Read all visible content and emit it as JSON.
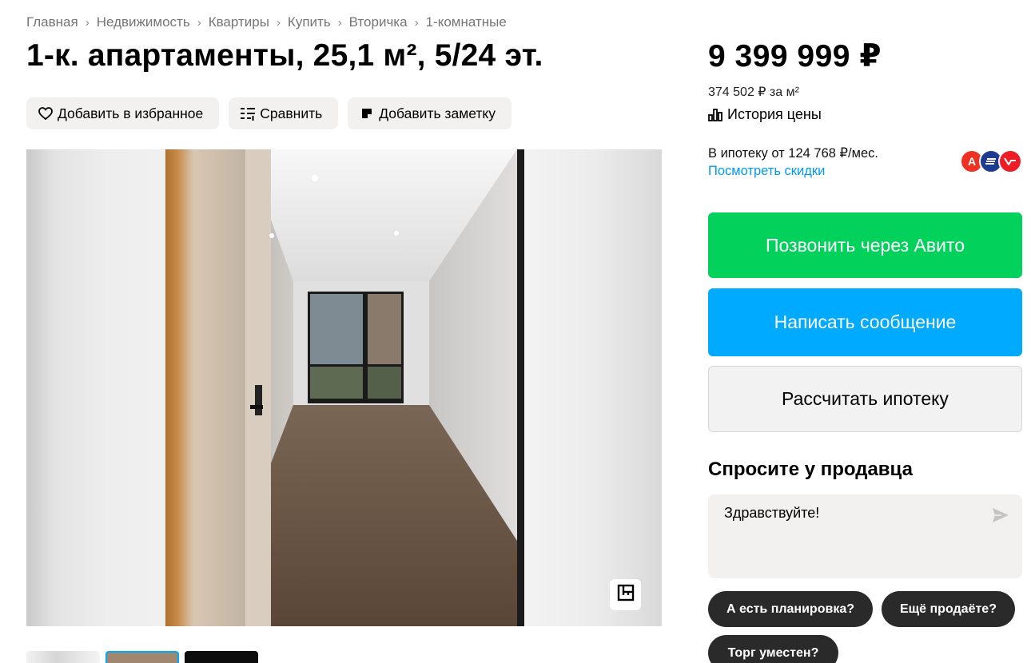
{
  "breadcrumbs": [
    "Главная",
    "Недвижимость",
    "Квартиры",
    "Купить",
    "Вторичка",
    "1-комнатные"
  ],
  "title": "1-к. апартаменты, 25,1 м², 5/24 эт.",
  "actions": {
    "favorite": "Добавить в избранное",
    "compare": "Сравнить",
    "note": "Добавить заметку"
  },
  "gallery": {
    "icons": [
      "floor-plan-icon"
    ]
  },
  "price": {
    "total": "9 399 999 ₽",
    "per_meter": "374 502 ₽ за м²",
    "history": "История цены"
  },
  "mortgage": {
    "text": "В ипотеку от 124 768 ₽/мес.",
    "link": "Посмотреть скидки",
    "banks": [
      {
        "letter": "А",
        "color": "#ef3124"
      },
      {
        "letter": "",
        "color": "#1d3b8f"
      },
      {
        "letter": "",
        "color": "#ee1c25"
      }
    ]
  },
  "buttons": {
    "call": "Позвонить через Авито",
    "message": "Написать сообщение",
    "calc_mortgage": "Рассчитать ипотеку"
  },
  "ask": {
    "title": "Спросите у продавца",
    "input_value": "Здравствуйте!",
    "chips": [
      "А есть планировка?",
      "Ещё продаёте?",
      "Торг уместен?"
    ]
  },
  "colors": {
    "green": "#02d15c",
    "blue": "#00aaff",
    "link": "#0099f7"
  }
}
